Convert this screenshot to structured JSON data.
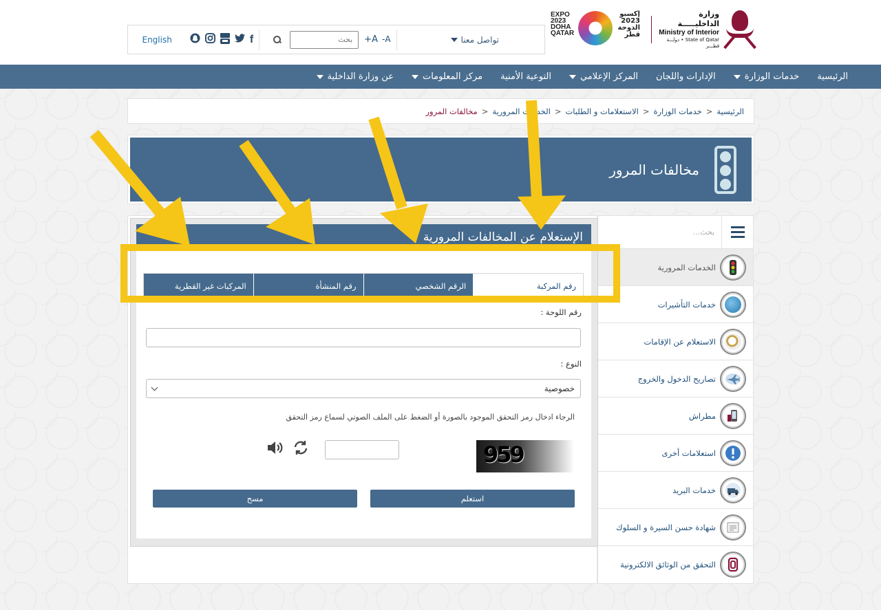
{
  "topbar": {
    "contact": "تواصل معنا",
    "font_smaller": "A-",
    "font_bigger": "A+",
    "search_placeholder": "بحث",
    "language": "English"
  },
  "logos": {
    "moi_ar": "وزارة الداخليـــــة",
    "moi_en": "Ministry of Interior",
    "moi_state": "State of Qatar • دولـــة قطـــر",
    "expo_en": [
      "EXPO",
      "2023",
      "DOHA",
      "QATAR"
    ],
    "expo_ar": [
      "إكسبو",
      "2023",
      "الدوحة",
      "قطر"
    ]
  },
  "nav": [
    {
      "label": "الرئيسية",
      "dropdown": false
    },
    {
      "label": "خدمات الوزارة",
      "dropdown": true
    },
    {
      "label": "الإدارات واللجان",
      "dropdown": false
    },
    {
      "label": "المركز الإعلامي",
      "dropdown": true
    },
    {
      "label": "التوعية الأمنية",
      "dropdown": false
    },
    {
      "label": "مركز المعلومات",
      "dropdown": true
    },
    {
      "label": "عن وزارة الداخلية",
      "dropdown": true
    }
  ],
  "breadcrumb": {
    "home": "الرئيسية",
    "services": "خدمات الوزارة",
    "inquiries": "الاستعلامات و الطلبات",
    "traffic": "الخدمات المرورية",
    "current": "مخالفات المرور"
  },
  "banner": {
    "title": "مخالفات المرور"
  },
  "sidebar": {
    "search_placeholder": "بحث...",
    "items": [
      {
        "label": "الخدمات المرورية",
        "icon": "traffic-light-icon",
        "color": "#7a4a2a"
      },
      {
        "label": "خدمات التأشيرات",
        "icon": "visa-globe-icon",
        "color": "#2a7ab0"
      },
      {
        "label": "الاستعلام عن الإقامات",
        "icon": "residency-search-icon",
        "color": "#c9a24a"
      },
      {
        "label": "تصاريح الدخول والخروج",
        "icon": "airplane-icon",
        "color": "#7aa2c8"
      },
      {
        "label": "مطراش",
        "icon": "metrash-phone-icon",
        "color": "#8a1538"
      },
      {
        "label": "استعلامات أخرى",
        "icon": "info-icon",
        "color": "#3a7cc4"
      },
      {
        "label": "خدمات البريد",
        "icon": "mail-truck-icon",
        "color": "#3b5a78"
      },
      {
        "label": "شهادة حسن السيرة و السلوك",
        "icon": "certificate-icon",
        "color": "#cfcfcf"
      },
      {
        "label": "التحقق من الوثائق الالكترونية",
        "icon": "document-verify-icon",
        "color": "#8a1538"
      }
    ]
  },
  "main": {
    "title": "الإستعلام عن المخالفات المرورية",
    "tabs": [
      "رقم المركبة",
      "الرقم الشخصي",
      "رقم المنشأة",
      "المركبات غير القطرية"
    ],
    "plate_label": "رقم اللوحة :",
    "type_label": "النوع :",
    "type_value": "خصوصية",
    "captcha_hint": "الرجاء ادخال رمز التحقق الموجود بالصورة أو الضغط على الملف الصوتي لسماع رمز التحقق",
    "captcha_text": "959",
    "submit": "استعلم",
    "clear": "مسح"
  },
  "colors": {
    "nav_blue": "#4a6e8f",
    "panel_blue": "#456a8d",
    "maroon": "#8a1538",
    "annotation_yellow": "#f5c518"
  }
}
